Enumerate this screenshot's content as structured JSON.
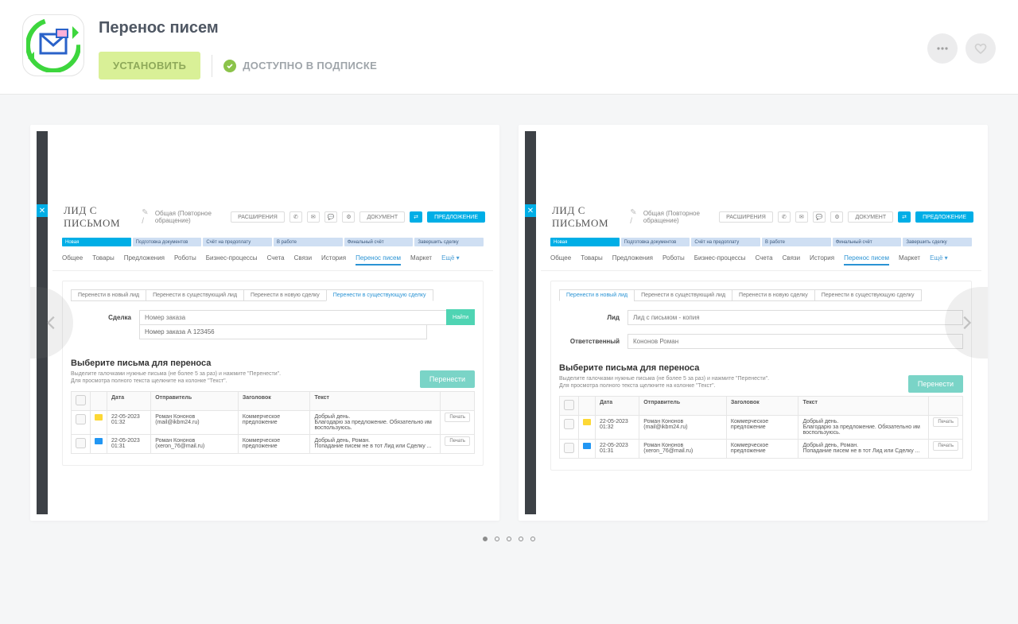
{
  "header": {
    "title": "Перенос писем",
    "install_label": "УСТАНОВИТЬ",
    "subscription_label": "ДОСТУПНО В ПОДПИСКЕ"
  },
  "gallery": {
    "dots_total": 5,
    "active_dot": 0
  },
  "mock": {
    "lead_title": "ЛИД С ПИСЬМОМ",
    "breadcrumb": "Общая (Повторное обращение)",
    "header_btns": {
      "ext": "РАСШИРЕНИЯ",
      "doc": "ДОКУМЕНТ",
      "offer": "ПРЕДЛОЖЕНИЕ"
    },
    "stages": [
      "Новая",
      "Подготовка документов",
      "Счёт на предоплату",
      "В работе",
      "Финальный счёт",
      "Завершить сделку"
    ],
    "tabs": [
      "Общее",
      "Товары",
      "Предложения",
      "Роботы",
      "Бизнес-процессы",
      "Счета",
      "Связи",
      "История",
      "Перенос писем",
      "Маркет",
      "Ещё ▾"
    ],
    "sub_tabs": [
      "Перенести в новый лид",
      "Перенести в существующий лид",
      "Перенести в новую сделку",
      "Перенести в существующую сделку"
    ],
    "labels": {
      "deal": "Сделка",
      "lead": "Лид",
      "responsible": "Ответственный",
      "deal_placeholder": "Номер заказа",
      "deal_hint": "Номер заказа А 123456",
      "lead_value": "Лид с письмом - копия",
      "responsible_value": "Кононов Роман",
      "find": "Найти"
    },
    "section": {
      "title": "Выберите письма для переноса",
      "desc1": "Выделите галочками нужные письма (не более 5 за раз) и нажмите \"Перенести\".",
      "desc2": "Для просмотра полного текста щелкните на колонке \"Текст\".",
      "transfer": "Перенести"
    },
    "table": {
      "cols": [
        "",
        "",
        "Дата",
        "Отправитель",
        "Заголовок",
        "Текст",
        ""
      ],
      "rows": [
        {
          "date": "22-05-2023 01:32",
          "sender": "Роман Кононов (mail@ikbm24.ru)",
          "subject": "Коммерческое предложение",
          "text": "Добрый день.\nБлагодарю за предложение. Обязательно им воспользуюсь.",
          "icon": "yellow",
          "print": "Печать"
        },
        {
          "date": "22-05-2023 01:31",
          "sender": "Роман Кононов (xeron_76@mail.ru)",
          "subject": "Коммерческое предложение",
          "text": "Добрый день, Роман.\nПопадание писем не в тот Лид или Сделку ...",
          "icon": "blue",
          "print": "Печать"
        }
      ]
    }
  }
}
